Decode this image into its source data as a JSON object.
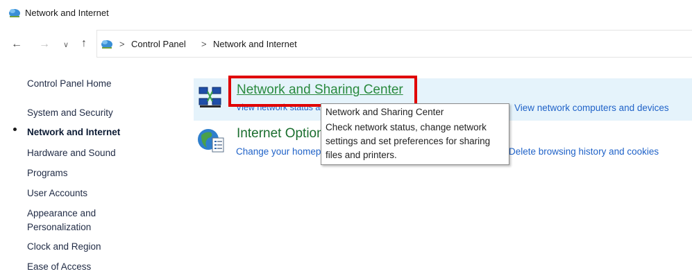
{
  "window": {
    "title": "Network and Internet",
    "icon": "network-globe-icon"
  },
  "nav": {
    "back_icon": "arrow-left-icon",
    "forward_icon": "arrow-right-icon",
    "recent_icon": "chevron-down-icon",
    "up_icon": "arrow-up-icon",
    "back_glyph": "←",
    "forward_glyph": "→",
    "recent_glyph": "∨",
    "up_glyph": "↑"
  },
  "address": {
    "separator": ">",
    "crumbs": [
      "Control Panel",
      "Network and Internet"
    ]
  },
  "sidebar": {
    "items": [
      {
        "label": "Control Panel Home"
      },
      {
        "label": "System and Security"
      },
      {
        "label": "Network and Internet",
        "active": true
      },
      {
        "label": "Hardware and Sound"
      },
      {
        "label": "Programs"
      },
      {
        "label": "User Accounts"
      },
      {
        "label": "Appearance and Personalization"
      },
      {
        "label": "Clock and Region"
      },
      {
        "label": "Ease of Access"
      }
    ]
  },
  "main": {
    "categories": [
      {
        "title": "Network and Sharing Center",
        "icon": "network-sharing-icon",
        "links": [
          "View network status and tasks",
          "View network computers and devices"
        ]
      },
      {
        "title": "Internet Options",
        "icon": "internet-options-icon",
        "links": [
          "Change your homepage",
          "Delete browsing history and cookies"
        ]
      }
    ]
  },
  "tooltip": {
    "title": "Network and Sharing Center",
    "body": "Check network status, change network settings and set preferences for sharing files and printers."
  },
  "colors": {
    "highlight": "#e5f3fb",
    "link": "#1f62c8",
    "category_title": "#2a8a3e",
    "annotation_box": "#e00000"
  }
}
